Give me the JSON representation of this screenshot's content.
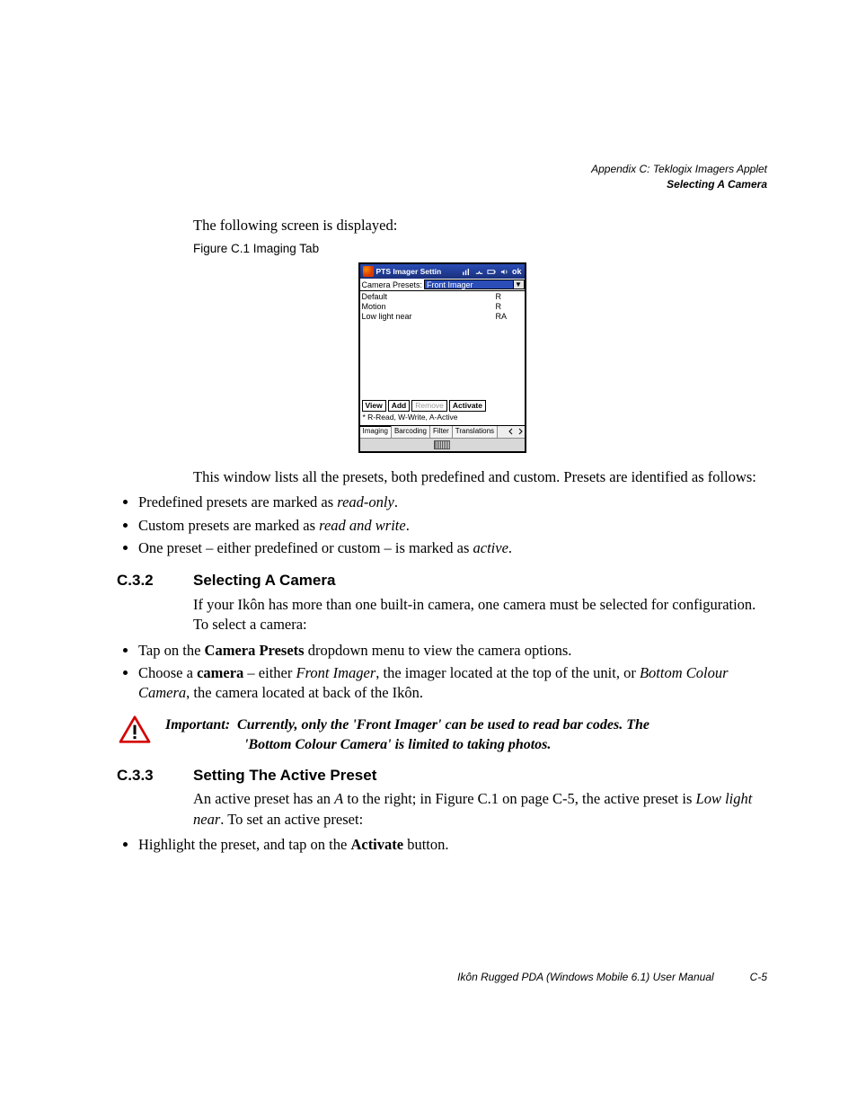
{
  "running_head": {
    "line1": "Appendix C: Teklogix Imagers Applet",
    "line2": "Selecting A Camera"
  },
  "intro_line": "The following screen is displayed:",
  "figure_caption": "Figure C.1  Imaging Tab",
  "screenshot": {
    "title": "PTS Imager Settin",
    "ok": "ok",
    "presets_label": "Camera Presets:",
    "presets_value": "Front Imager",
    "rows": [
      {
        "name": "Default",
        "flags": "R"
      },
      {
        "name": "Motion",
        "flags": "R"
      },
      {
        "name": "Low light near",
        "flags": "RA"
      }
    ],
    "buttons": {
      "view": "View",
      "add": "Add",
      "remove": "Remove",
      "activate": "Activate"
    },
    "legend": "* R-Read, W-Write, A-Active",
    "tabs": {
      "imaging": "Imaging",
      "barcoding": "Barcoding",
      "filter": "Filter",
      "translations": "Translations"
    }
  },
  "after_fig_p": "This window lists all the presets, both predefined and custom. Presets are identified as follows:",
  "preset_bullets": {
    "b1a": "Predefined presets are marked as ",
    "b1b": "read-only",
    "b1c": ".",
    "b2a": "Custom presets are marked as ",
    "b2b": "read and write",
    "b2c": ".",
    "b3a": "One preset – either predefined or custom – is marked as ",
    "b3b": "active",
    "b3c": "."
  },
  "sec_c32": {
    "num": "C.3.2",
    "title": "Selecting A Camera",
    "p1": "If your Ikôn has more than one built-in camera, one camera must be selected for configuration. To select a camera:",
    "b1a": "Tap on the ",
    "b1b": "Camera Presets",
    "b1c": " dropdown menu to view the camera options.",
    "b2a": "Choose a ",
    "b2b": "camera",
    "b2c": " – either ",
    "b2d": "Front Imager",
    "b2e": ", the imager located at the top of the unit, or ",
    "b2f": "Bottom Colour Camera",
    "b2g": ", the camera located at back of the Ikôn."
  },
  "important": {
    "lead": "Important:",
    "l1": "Currently, only the 'Front Imager' can be used to read bar codes. The",
    "l2": "'Bottom Colour Camera' is limited to taking photos."
  },
  "sec_c33": {
    "num": "C.3.3",
    "title": "Setting The Active Preset",
    "p1a": "An active preset has an ",
    "p1b": "A",
    "p1c": " to the right; in Figure C.1 on page C-5, the active preset is ",
    "p1d": "Low light near",
    "p1e": ". To set an active preset:",
    "b1a": "Highlight the preset, and tap on the ",
    "b1b": "Activate",
    "b1c": " button."
  },
  "footer": {
    "title": "Ikôn Rugged PDA (Windows Mobile 6.1) User Manual",
    "pnum": "C-5"
  }
}
